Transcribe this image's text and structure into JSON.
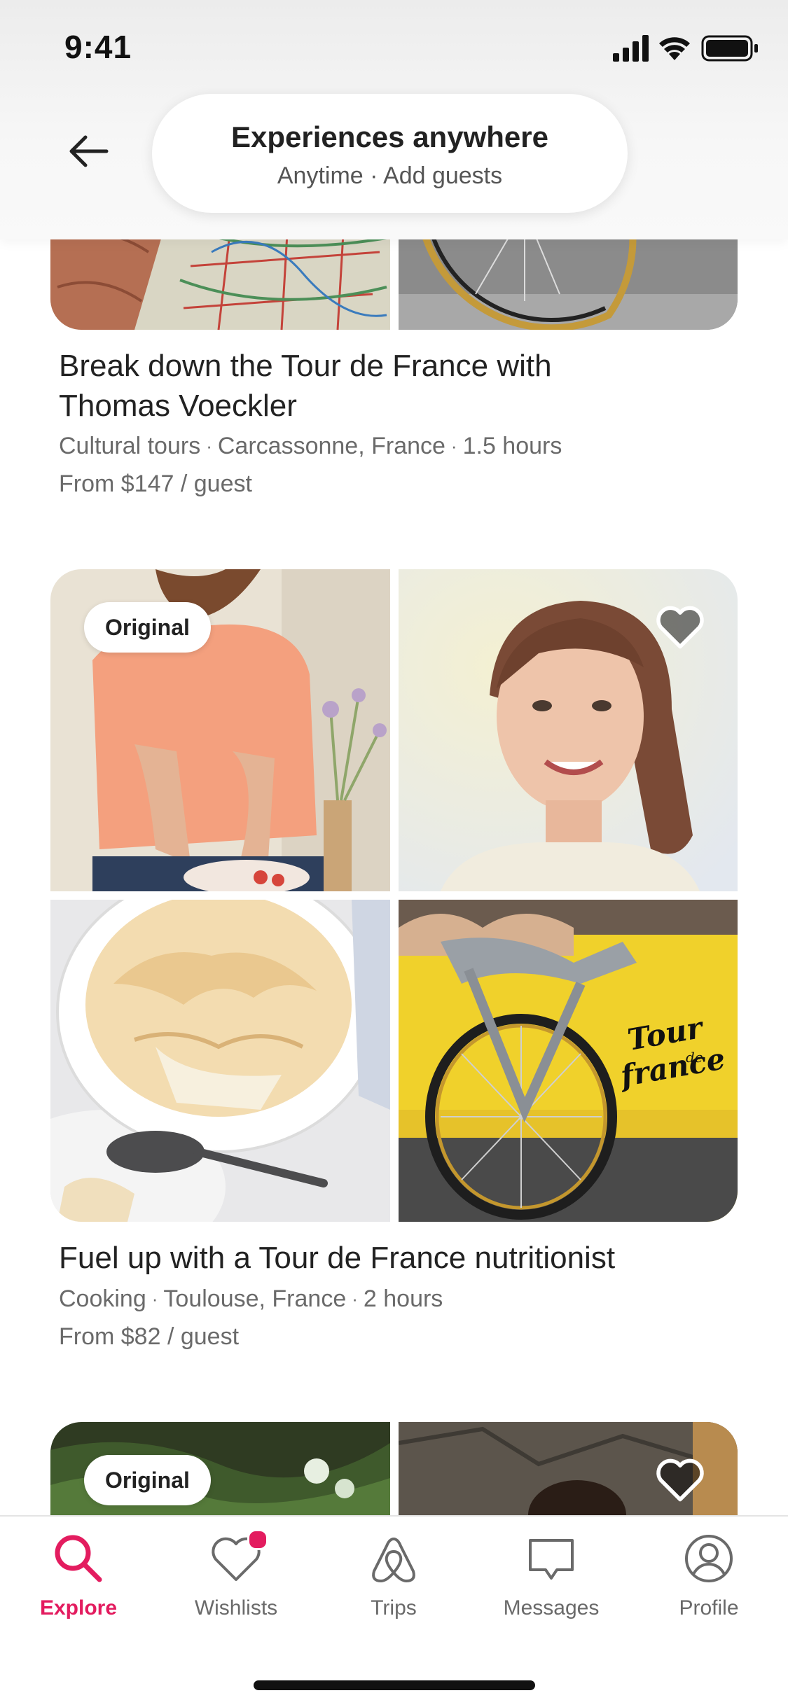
{
  "status_bar": {
    "time": "9:41"
  },
  "header": {
    "search_title": "Experiences anywhere",
    "search_subtitle": "Anytime · Add guests"
  },
  "listings": [
    {
      "title": "Break down the Tour de France with Thomas Voeckler",
      "category": "Cultural tours",
      "location": "Carcassonne, France",
      "duration": "1.5 hours",
      "price": "From $147 / guest"
    },
    {
      "badge": "Original",
      "title": "Fuel up with a Tour de France nutritionist",
      "category": "Cooking",
      "location": "Toulouse, France",
      "duration": "2 hours",
      "price": "From $82 / guest"
    },
    {
      "badge": "Original"
    }
  ],
  "photo_labels": {
    "banner_text": "Tour de France"
  },
  "tab_bar": {
    "tabs": [
      {
        "label": "Explore",
        "icon": "search-icon",
        "active": true
      },
      {
        "label": "Wishlists",
        "icon": "heart-icon",
        "notification": true
      },
      {
        "label": "Trips",
        "icon": "airbnb-logo-icon"
      },
      {
        "label": "Messages",
        "icon": "message-icon"
      },
      {
        "label": "Profile",
        "icon": "profile-icon"
      }
    ]
  },
  "colors": {
    "accent": "#e31c5f",
    "text": "#222222",
    "muted": "#6a6a6a"
  }
}
